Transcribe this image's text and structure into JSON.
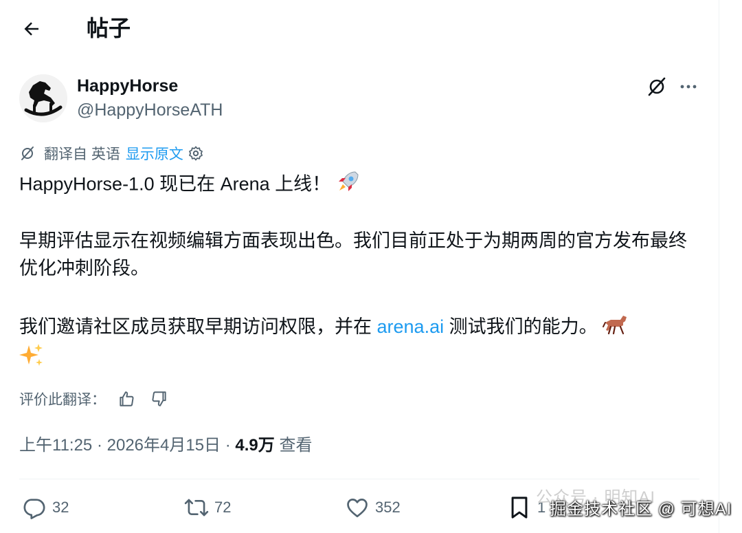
{
  "header": {
    "title": "帖子"
  },
  "author": {
    "display_name": "HappyHorse",
    "handle": "@HappyHorseATH"
  },
  "translation": {
    "label": "翻译自 英语",
    "show_original": "显示原文"
  },
  "post": {
    "line1_text": "HappyHorse-1.0 现已在 Arena 上线！",
    "paragraph2": "早期评估显示在视频编辑方面表现出色。我们目前正处于为期两周的官方发布最终优化冲刺阶段。",
    "paragraph3_before": "我们邀请社区成员获取早期访问权限，并在 ",
    "paragraph3_link": "arena.ai",
    "paragraph3_after": " 测试我们的能力。"
  },
  "rate": {
    "label": "评价此翻译："
  },
  "meta": {
    "time": "上午11:25",
    "sep1": "·",
    "date": "2026年4月15日",
    "sep2": "·",
    "views_count": "4.9万",
    "views_label": "查看"
  },
  "actions": {
    "reply_count": "32",
    "repost_count": "72",
    "like_count": "352",
    "bookmark_count": "1"
  },
  "watermark": {
    "faded": "公众号 · 明知AI",
    "overlay": "掘金技术社区 @ 可想AI"
  },
  "colors": {
    "link": "#1d9bf0",
    "secondary": "#536471",
    "primary": "#0f1419"
  },
  "icons": [
    "back-arrow-icon",
    "grok-icon",
    "more-icon",
    "translate-icon",
    "settings-icon",
    "rocket-emoji",
    "horse-emoji",
    "sparkles-emoji",
    "thumbs-up-icon",
    "thumbs-down-icon",
    "reply-icon",
    "repost-icon",
    "like-icon",
    "bookmark-icon"
  ]
}
